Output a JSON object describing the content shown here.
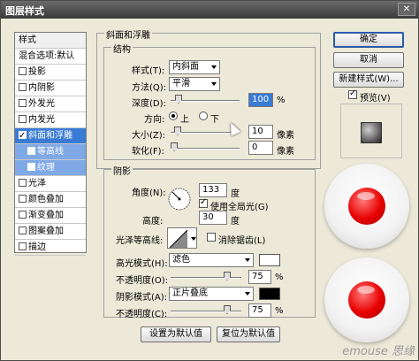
{
  "window": {
    "title": "图层样式",
    "close": "✕"
  },
  "style_list": {
    "header": "样式",
    "items": [
      {
        "label": "混合选项:默认",
        "checkbox": false
      },
      {
        "label": "投影",
        "checkbox": true,
        "checked": false
      },
      {
        "label": "内阴影",
        "checkbox": true,
        "checked": false
      },
      {
        "label": "外发光",
        "checkbox": true,
        "checked": false
      },
      {
        "label": "内发光",
        "checkbox": true,
        "checked": false
      },
      {
        "label": "斜面和浮雕",
        "checkbox": true,
        "checked": true,
        "selected": true
      },
      {
        "label": "等高线",
        "checkbox": true,
        "checked": false,
        "sub": true
      },
      {
        "label": "纹理",
        "checkbox": true,
        "checked": false,
        "sub": true
      },
      {
        "label": "光泽",
        "checkbox": true,
        "checked": false
      },
      {
        "label": "颜色叠加",
        "checkbox": true,
        "checked": false
      },
      {
        "label": "渐变叠加",
        "checkbox": true,
        "checked": false
      },
      {
        "label": "图案叠加",
        "checkbox": true,
        "checked": false
      },
      {
        "label": "描边",
        "checkbox": true,
        "checked": false
      }
    ]
  },
  "bevel": {
    "section_title": "斜面和浮雕",
    "structure": {
      "title": "结构",
      "style_label": "样式(T):",
      "style_value": "内斜面",
      "method_label": "方法(Q):",
      "method_value": "平滑",
      "depth_label": "深度(D):",
      "depth_value": "100",
      "depth_unit": "%",
      "direction_label": "方向:",
      "dir_up": "上",
      "dir_down": "下",
      "direction_selected": "up",
      "size_label": "大小(Z):",
      "size_value": "10",
      "size_unit": "像素",
      "soften_label": "软化(F):",
      "soften_value": "0",
      "soften_unit": "像素"
    },
    "shading": {
      "title": "阴影",
      "angle_label": "角度(N):",
      "angle_value": "133",
      "angle_unit": "度",
      "global_light_label": "使用全局光(G)",
      "global_light": true,
      "altitude_label": "高度:",
      "altitude_value": "30",
      "altitude_unit": "度",
      "gloss_contour_label": "光泽等高线:",
      "anti_aliased_label": "消除锯齿(L)",
      "anti_aliased": false,
      "highlight_mode_label": "高光模式(H):",
      "highlight_mode_value": "滤色",
      "highlight_opacity_label": "不透明度(O):",
      "highlight_opacity_value": "75",
      "highlight_opacity_unit": "%",
      "highlight_color": "#ffffff",
      "shadow_mode_label": "阴影模式(A):",
      "shadow_mode_value": "正片叠底",
      "shadow_opacity_label": "不透明度(C):",
      "shadow_opacity_value": "75",
      "shadow_opacity_unit": "%",
      "shadow_color": "#000000"
    },
    "make_default": "设置为默认值",
    "reset_default": "复位为默认值"
  },
  "buttons": {
    "ok": "确定",
    "cancel": "取消",
    "new_style": "新建样式(W)...",
    "preview_label": "预览(V)",
    "preview_checked": true
  },
  "watermark": "emouse 思缘"
}
